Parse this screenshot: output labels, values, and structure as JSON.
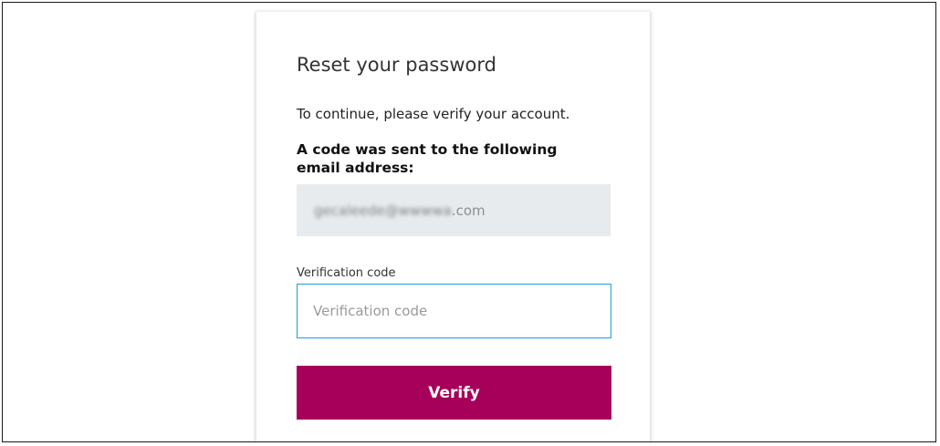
{
  "form": {
    "title": "Reset your password",
    "intro": "To continue, please verify your account.",
    "code_sent_text": "A code was sent to the following email address:",
    "email": {
      "local_part": "gecaleede",
      "domain": "@wwwwa",
      "tld": ".com"
    },
    "verification_label": "Verification code",
    "verification_placeholder": "Verification code",
    "verification_value": "",
    "verify_button": "Verify"
  },
  "colors": {
    "primary_button": "#a6005a",
    "input_focus_border": "#1f9fd3",
    "email_box_background": "#e8ebee"
  }
}
